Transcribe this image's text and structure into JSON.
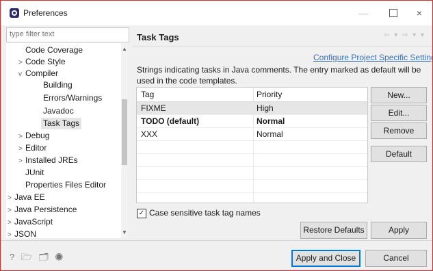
{
  "window": {
    "title": "Preferences",
    "minimize_glyph": "—",
    "close_glyph": "×"
  },
  "filter": {
    "placeholder": "type filter text"
  },
  "tree": {
    "items": [
      {
        "label": "Code Coverage",
        "arrow": ""
      },
      {
        "label": "Code Style",
        "arrow": ">"
      },
      {
        "label": "Compiler",
        "arrow": "v"
      },
      {
        "label": "Building",
        "arrow": ""
      },
      {
        "label": "Errors/Warnings",
        "arrow": ""
      },
      {
        "label": "Javadoc",
        "arrow": ""
      },
      {
        "label": "Task Tags",
        "arrow": ""
      },
      {
        "label": "Debug",
        "arrow": ">"
      },
      {
        "label": "Editor",
        "arrow": ">"
      },
      {
        "label": "Installed JREs",
        "arrow": ">"
      },
      {
        "label": "JUnit",
        "arrow": ""
      },
      {
        "label": "Properties Files Editor",
        "arrow": ""
      },
      {
        "label": "Java EE",
        "arrow": ">"
      },
      {
        "label": "Java Persistence",
        "arrow": ">"
      },
      {
        "label": "JavaScript",
        "arrow": ">"
      },
      {
        "label": "JSON",
        "arrow": ">"
      }
    ],
    "scroll_up": "▲",
    "scroll_down": "▼"
  },
  "page": {
    "title": "Task Tags",
    "nav_icons": "⇦ ▾ ⇨ ▾ ▾",
    "configure_link": "Configure Project Specific Settings...",
    "description": "Strings indicating tasks in Java comments. The entry marked as default will be used in the code templates."
  },
  "table": {
    "headers": [
      "Tag",
      "Priority"
    ],
    "rows": [
      {
        "tag": "FIXME",
        "priority": "High"
      },
      {
        "tag": "TODO (default)",
        "priority": "Normal"
      },
      {
        "tag": "XXX",
        "priority": "Normal"
      }
    ]
  },
  "buttons": {
    "new": "New...",
    "edit": "Edit...",
    "remove": "Remove",
    "default": "Default",
    "restore_defaults": "Restore Defaults",
    "apply": "Apply",
    "apply_and_close": "Apply and Close",
    "cancel": "Cancel"
  },
  "checkbox": {
    "label": "Case sensitive task tag names",
    "checked": true,
    "check_glyph": "✓"
  },
  "footer": {
    "icons": "? 🗁 🗂 ◉"
  }
}
